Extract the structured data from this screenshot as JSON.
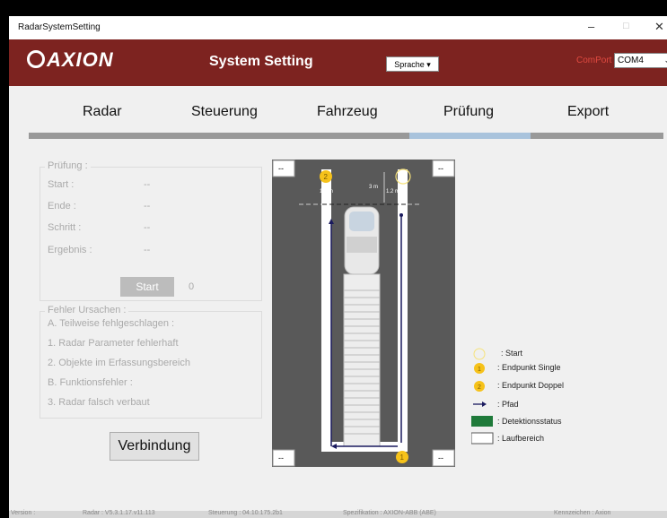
{
  "window": {
    "title": "RadarSystemSetting",
    "controls": {
      "minimize": "–",
      "maximize": "□",
      "close": "✕"
    }
  },
  "header": {
    "logo_text": "AXION",
    "title": "System Setting",
    "language_button": "Sprache ▾",
    "comport_label": "ComPort",
    "comport_value": "COM4",
    "colors": {
      "brand": "#7d2320",
      "comport_label": "#e04a40"
    }
  },
  "tabs": [
    {
      "label": "Radar"
    },
    {
      "label": "Steuerung"
    },
    {
      "label": "Fahrzeug"
    },
    {
      "label": "Prüfung",
      "active": true
    },
    {
      "label": "Export"
    }
  ],
  "pruefung": {
    "title": "Prüfung :",
    "rows": [
      {
        "label": "Start :",
        "value": "--"
      },
      {
        "label": "Ende :",
        "value": "--"
      },
      {
        "label": "Schritt :",
        "value": "--"
      },
      {
        "label": "Ergebnis :",
        "value": "--"
      }
    ],
    "start_button": "Start",
    "count": "0"
  },
  "fehler": {
    "title": "Fehler Ursachen :",
    "items": [
      "A. Teilweise fehlgeschlagen :",
      "1. Radar Parameter fehlerhaft",
      "2. Objekte im Erfassungsbereich",
      "B. Funktionsfehler :",
      "3. Radar falsch verbaut"
    ]
  },
  "verbindung_button": "Verbindung",
  "diagram": {
    "corner_buttons": {
      "top_left": "--",
      "top_right": "--",
      "bottom_left": "--",
      "bottom_right": "--"
    },
    "marker_single": "1",
    "marker_double": "2",
    "dims": {
      "left": "1.2 m",
      "right": "1.2 m",
      "three": "3 m"
    }
  },
  "legend": [
    {
      "icon": "start-circle-icon",
      "text": ": Start"
    },
    {
      "icon": "endpoint-single-icon",
      "text": ": Endpunkt Single",
      "marker": "1"
    },
    {
      "icon": "endpoint-double-icon",
      "text": ": Endpunkt Doppel",
      "marker": "2"
    },
    {
      "icon": "path-arrow-icon",
      "text": ": Pfad"
    },
    {
      "icon": "detection-status-swatch",
      "text": ": Detektionsstatus",
      "color": "#1f7a3a"
    },
    {
      "icon": "walk-area-swatch",
      "text": ": Laufbereich",
      "color": "#ffffff"
    }
  ],
  "statusbar": {
    "version": "Version :",
    "radar": "Radar : V5.3.1.17.v11.113",
    "steuerung": "Steuerung : 04.10.175.2b1",
    "spezifikation": "Spezifikation : AXION-ABB (ABE)",
    "kennzeichen": "Kennzeichen : Axion"
  }
}
